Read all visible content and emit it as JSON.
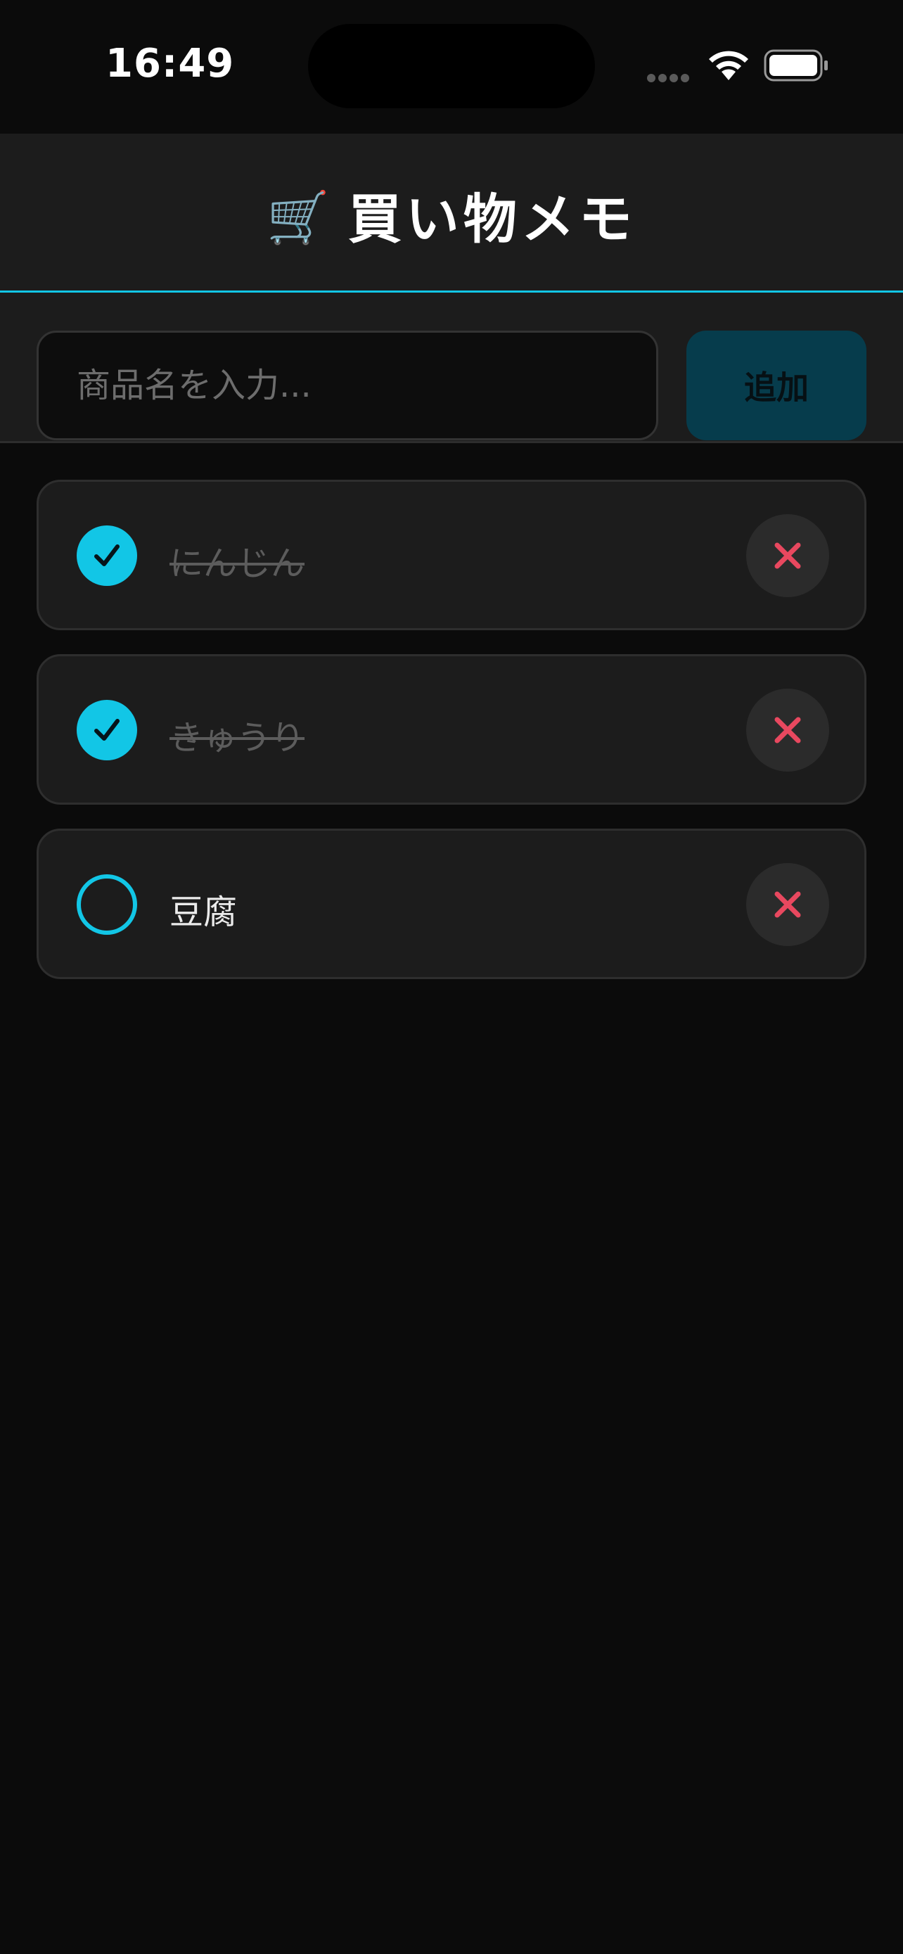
{
  "status": {
    "time": "16:49"
  },
  "header": {
    "cart_icon": "🛒",
    "title": "買い物メモ",
    "accent": "#12c6e6"
  },
  "input": {
    "placeholder": "商品名を入力...",
    "value": "",
    "add_label": "追加"
  },
  "items": [
    {
      "name": "にんじん",
      "checked": true
    },
    {
      "name": "きゅうり",
      "checked": true
    },
    {
      "name": "豆腐",
      "checked": false
    }
  ],
  "icons": {
    "check": "checkmark-icon",
    "delete": "close-icon"
  },
  "colors": {
    "delete_x": "#e8485f",
    "background": "#0b0b0b",
    "card": "#1c1c1c"
  }
}
